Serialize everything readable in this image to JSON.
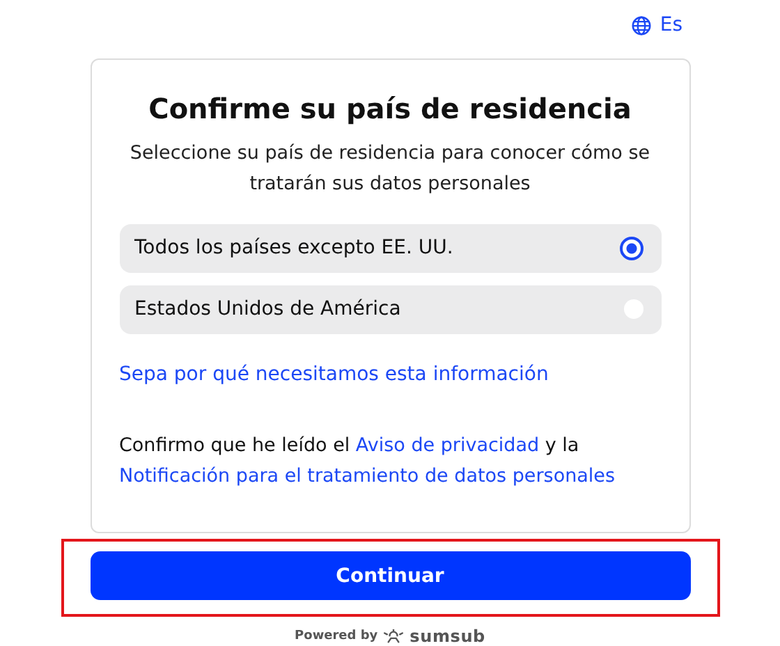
{
  "language": {
    "label": "Es"
  },
  "title": "Confirme su país de residencia",
  "subtitle": "Seleccione su país de residencia para conocer cómo se tratarán sus datos personales",
  "options": [
    {
      "label": "Todos los países excepto EE. UU.",
      "selected": true
    },
    {
      "label": "Estados Unidos de América",
      "selected": false
    }
  ],
  "info_link": "Sepa por qué necesitamos esta información",
  "consent": [
    {
      "kind": "text",
      "text": "Confirmo que he leído el "
    },
    {
      "kind": "link",
      "text": "Aviso de privacidad"
    },
    {
      "kind": "text",
      "text": " y la "
    },
    {
      "kind": "link",
      "text": "Notificación para el tratamiento de datos personales"
    }
  ],
  "continue_button": "Continuar",
  "footer": {
    "powered_by": "Powered by",
    "brand": "sumsub"
  }
}
